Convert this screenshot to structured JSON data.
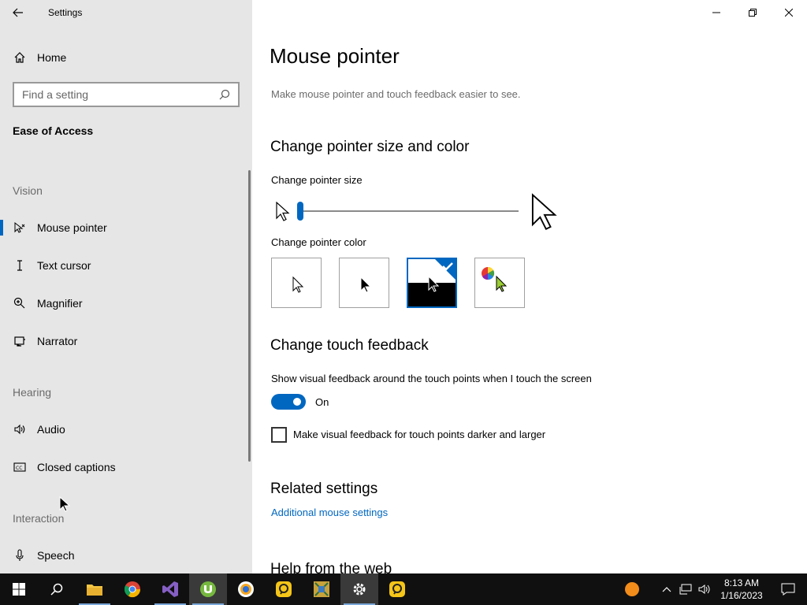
{
  "window": {
    "app_title": "Settings",
    "minimize_glyph": "—",
    "restore_glyph": "❐",
    "close_glyph": "✕"
  },
  "sidebar": {
    "home_label": "Home",
    "search_placeholder": "Find a setting",
    "section_title": "Ease of Access",
    "groups": {
      "vision": "Vision",
      "hearing": "Hearing",
      "interaction": "Interaction"
    },
    "items": [
      {
        "label": "Mouse pointer",
        "icon": "mouse-pointer-icon",
        "selected": true
      },
      {
        "label": "Text cursor",
        "icon": "text-cursor-icon"
      },
      {
        "label": "Magnifier",
        "icon": "magnifier-icon"
      },
      {
        "label": "Narrator",
        "icon": "narrator-icon"
      },
      {
        "label": "Audio",
        "icon": "audio-icon"
      },
      {
        "label": "Closed captions",
        "icon": "closed-captions-icon"
      },
      {
        "label": "Speech",
        "icon": "microphone-icon"
      }
    ]
  },
  "main": {
    "title": "Mouse pointer",
    "description": "Make mouse pointer and touch feedback easier to see.",
    "pointer_section": "Change pointer size and color",
    "size_label": "Change pointer size",
    "size_value": 1,
    "color_label": "Change pointer color",
    "color_options": [
      "white",
      "black",
      "inverted",
      "custom"
    ],
    "selected_color": "inverted",
    "touch_section": "Change touch feedback",
    "touch_label": "Show visual feedback around the touch points when I touch the screen",
    "toggle_state": "On",
    "checkbox_label": "Make visual feedback for touch points darker and larger",
    "checkbox_checked": false,
    "related_section": "Related settings",
    "related_link": "Additional mouse settings",
    "help_section": "Help from the web"
  },
  "taskbar": {
    "apps": [
      "start",
      "search",
      "file-explorer",
      "chrome",
      "visual-studio",
      "utorrent",
      "browser",
      "app-yellow",
      "game-app",
      "settings",
      "app-yellow-2"
    ],
    "time": "8:13 AM",
    "date": "1/16/2023"
  },
  "colors": {
    "accent": "#0067c0",
    "sidebar_bg": "#e6e6e6",
    "taskbar_bg": "#101010"
  }
}
